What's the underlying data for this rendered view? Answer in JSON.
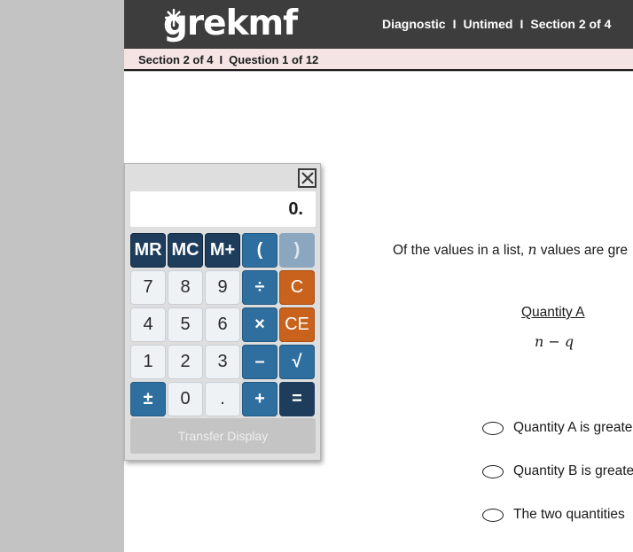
{
  "header": {
    "logo": "grekmf",
    "nav": [
      "Diagnostic",
      "Untimed",
      "Section 2 of 4"
    ],
    "separator": "I"
  },
  "subheader": {
    "section": "Section 2 of 4",
    "question": "Question 1 of 12",
    "separator": "I"
  },
  "calculator": {
    "display": "0.",
    "keys": {
      "mr": "MR",
      "mc": "MC",
      "mplus": "M+",
      "lparen": "(",
      "rparen": ")",
      "k7": "7",
      "k8": "8",
      "k9": "9",
      "div": "÷",
      "clear": "C",
      "k4": "4",
      "k5": "5",
      "k6": "6",
      "mul": "×",
      "clear_entry": "CE",
      "k1": "1",
      "k2": "2",
      "k3": "3",
      "minus": "–",
      "sqrt": "√",
      "plusminus": "±",
      "k0": "0",
      "dot": ".",
      "plus": "+",
      "equals": "="
    },
    "transfer_label": "Transfer Display"
  },
  "question": {
    "prefix": "Of the values in a list, ",
    "var": "n",
    "suffix": " values are gre",
    "quantity_a": {
      "heading": "Quantity A",
      "expression": "n − q"
    },
    "options": [
      "Quantity A is greate",
      "Quantity B is greate",
      "The two quantities"
    ]
  }
}
